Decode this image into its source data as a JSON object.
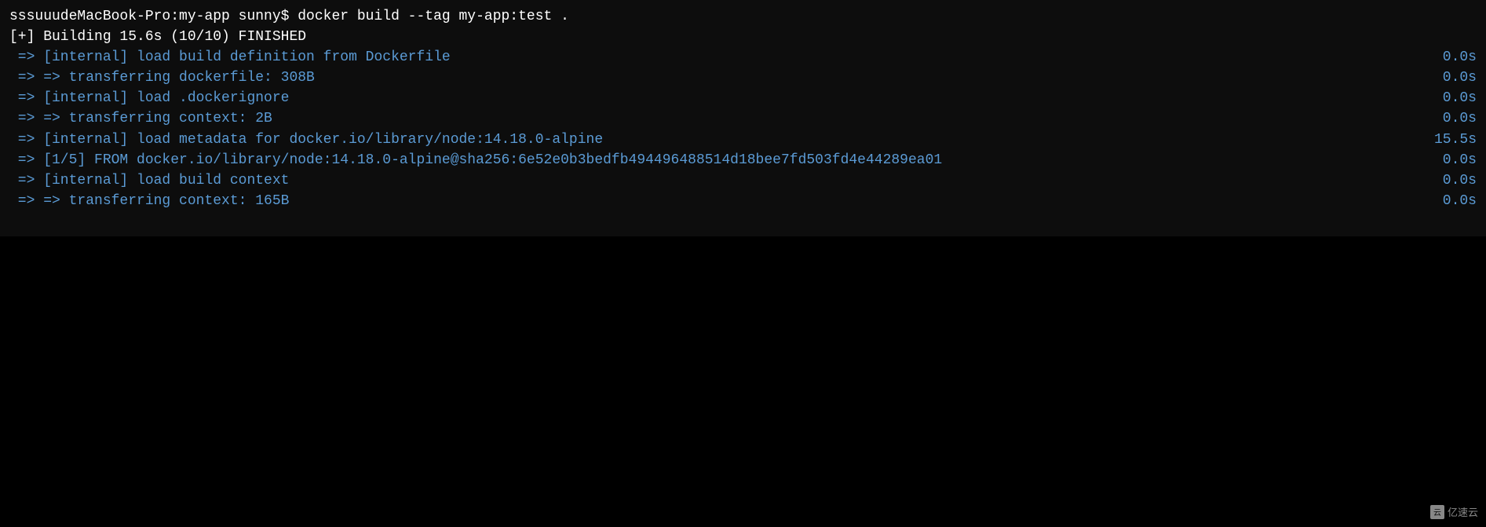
{
  "terminal": {
    "lines": [
      {
        "id": "prompt",
        "text": "sssuuudeMacBook-Pro:my-app sunny$ docker build --tag my-app:test .",
        "time": "",
        "type": "prompt"
      },
      {
        "id": "building",
        "text": "[+] Building 15.6s (10/10) FINISHED",
        "time": "",
        "type": "finished"
      },
      {
        "id": "step1",
        "text": " => [internal] load build definition from Dockerfile",
        "time": "0.0s",
        "type": "blue"
      },
      {
        "id": "step2",
        "text": " => => transferring dockerfile: 308B",
        "time": "0.0s",
        "type": "blue"
      },
      {
        "id": "step3",
        "text": " => [internal] load .dockerignore",
        "time": "0.0s",
        "type": "blue"
      },
      {
        "id": "step4",
        "text": " => => transferring context: 2B",
        "time": "0.0s",
        "type": "blue"
      },
      {
        "id": "step5",
        "text": " => [internal] load metadata for docker.io/library/node:14.18.0-alpine",
        "time": "15.5s",
        "type": "blue"
      },
      {
        "id": "step6",
        "text": " => [1/5] FROM docker.io/library/node:14.18.0-alpine@sha256:6e52e0b3bedfb494496488514d18bee7fd503fd4e44289ea01",
        "time": "0.0s",
        "type": "blue"
      },
      {
        "id": "step7",
        "text": " => [internal] load build context",
        "time": "0.0s",
        "type": "blue"
      },
      {
        "id": "step8",
        "text": " => => transferring context: 165B",
        "time": "0.0s",
        "type": "blue"
      }
    ],
    "watermark_text": "亿速云"
  }
}
